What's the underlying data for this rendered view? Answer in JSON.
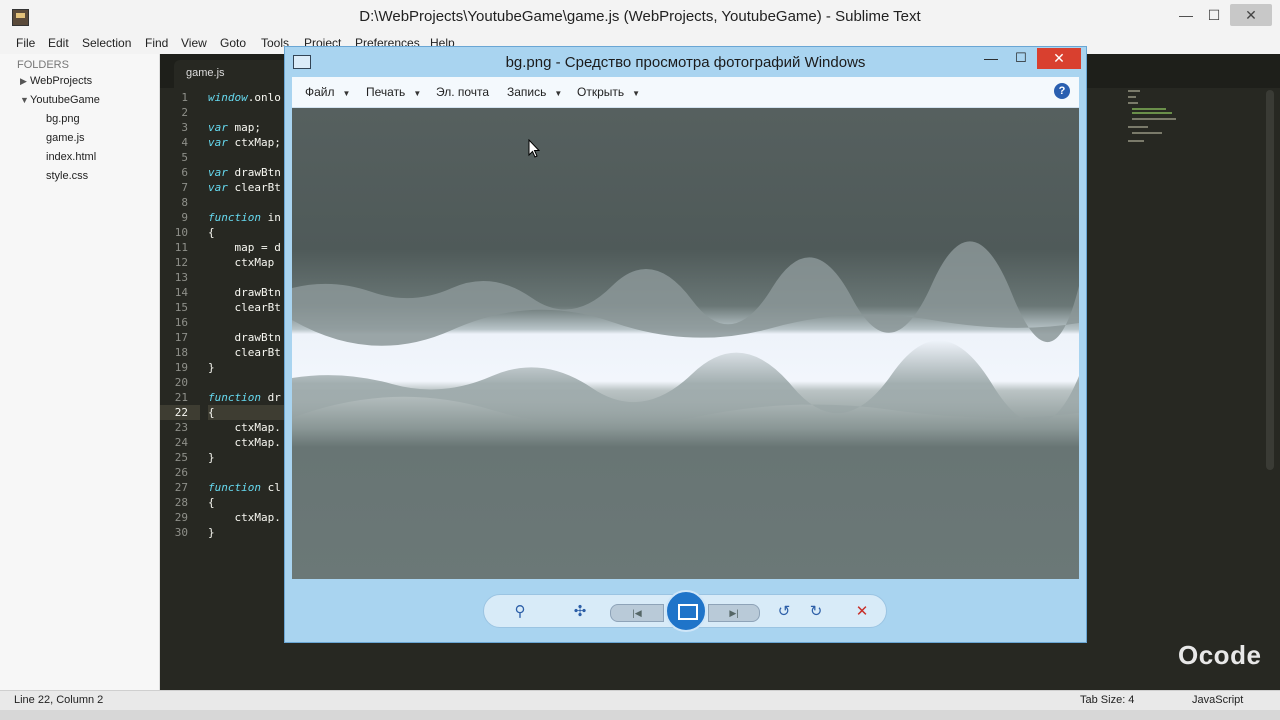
{
  "window": {
    "title": "D:\\WebProjects\\YoutubeGame\\game.js (WebProjects, YoutubeGame) - Sublime Text",
    "minimize": "—",
    "maximize": "☐",
    "close": "✕"
  },
  "menu": [
    "File",
    "Edit",
    "Selection",
    "Find",
    "View",
    "Goto",
    "Tools",
    "Project",
    "Preferences",
    "Help"
  ],
  "sidebar": {
    "header": "FOLDERS",
    "items": [
      {
        "label": "WebProjects",
        "type": "folder",
        "expanded": false
      },
      {
        "label": "YoutubeGame",
        "type": "folder",
        "expanded": true
      },
      {
        "label": "bg.png",
        "type": "file"
      },
      {
        "label": "game.js",
        "type": "file"
      },
      {
        "label": "index.html",
        "type": "file"
      },
      {
        "label": "style.css",
        "type": "file"
      }
    ]
  },
  "editor": {
    "tab_label": "game.js",
    "current_line": 22,
    "lines": [
      "window.onlo",
      "",
      "var map;",
      "var ctxMap;",
      "",
      "var drawBtn",
      "var clearBt",
      "",
      "function in",
      "{",
      "    map = d",
      "    ctxMap ",
      "",
      "    drawBtn",
      "    clearBt",
      "",
      "    drawBtn",
      "    clearBt",
      "}",
      "",
      "function dr",
      "{",
      "    ctxMap.",
      "    ctxMap.",
      "}",
      "",
      "function cl",
      "{",
      "    ctxMap.",
      "}"
    ]
  },
  "status": {
    "position": "Line 22, Column 2",
    "tab_size": "Tab Size: 4",
    "syntax": "JavaScript"
  },
  "watermark": "Ocode",
  "viewer": {
    "title": "bg.png - Средство просмотра фотографий Windows",
    "menu": [
      {
        "label": "Файл",
        "dropdown": true
      },
      {
        "label": "Печать",
        "dropdown": true
      },
      {
        "label": "Эл. почта",
        "dropdown": false
      },
      {
        "label": "Запись",
        "dropdown": true
      },
      {
        "label": "Открыть",
        "dropdown": true
      }
    ],
    "help": "?",
    "close": "✕",
    "toolbar": {
      "zoom": "⚲",
      "actual_size": "✣",
      "prev": "|◀",
      "next": "▶|",
      "rotate_ccw": "↺",
      "rotate_cw": "↻",
      "delete": "✕"
    }
  },
  "colors": {
    "editor_bg": "#272822",
    "viewer_frame": "#a9d4f0",
    "close_red": "#d9402f",
    "keyword": "#66d9ef"
  }
}
